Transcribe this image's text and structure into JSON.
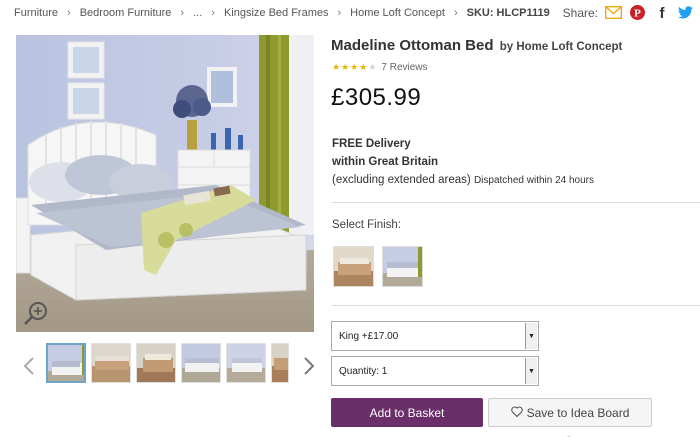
{
  "breadcrumb": {
    "items": [
      "Furniture",
      "Bedroom Furniture",
      "...",
      "Kingsize Bed Frames",
      "Home Loft Concept"
    ],
    "sku": "SKU: HLCP1119"
  },
  "share": {
    "label": "Share:",
    "icons": [
      "email-icon",
      "pinterest-icon",
      "facebook-icon",
      "twitter-icon"
    ]
  },
  "product": {
    "name": "Madeline Ottoman Bed",
    "by": "by Home Loft Concept",
    "rating": 3.5,
    "reviews": "7 Reviews",
    "price": "£305.99"
  },
  "delivery": {
    "line1": "FREE Delivery",
    "line2": "within Great Britain",
    "line3": "(excluding extended areas)",
    "dispatch": "Dispatched within 24 hours"
  },
  "finish": {
    "label": "Select Finish:",
    "options": [
      "brown-finish",
      "white-finish"
    ]
  },
  "options": {
    "size": "King +£17.00",
    "quantity": "Quantity: 1"
  },
  "buttons": {
    "basket": "Add to Basket",
    "idea": "Save to Idea Board"
  },
  "colors": {
    "accent": "#6a2e68",
    "star": "#e8b400",
    "pinterest": "#cb2027",
    "twitter": "#1da1f2",
    "email": "#f0a500"
  }
}
